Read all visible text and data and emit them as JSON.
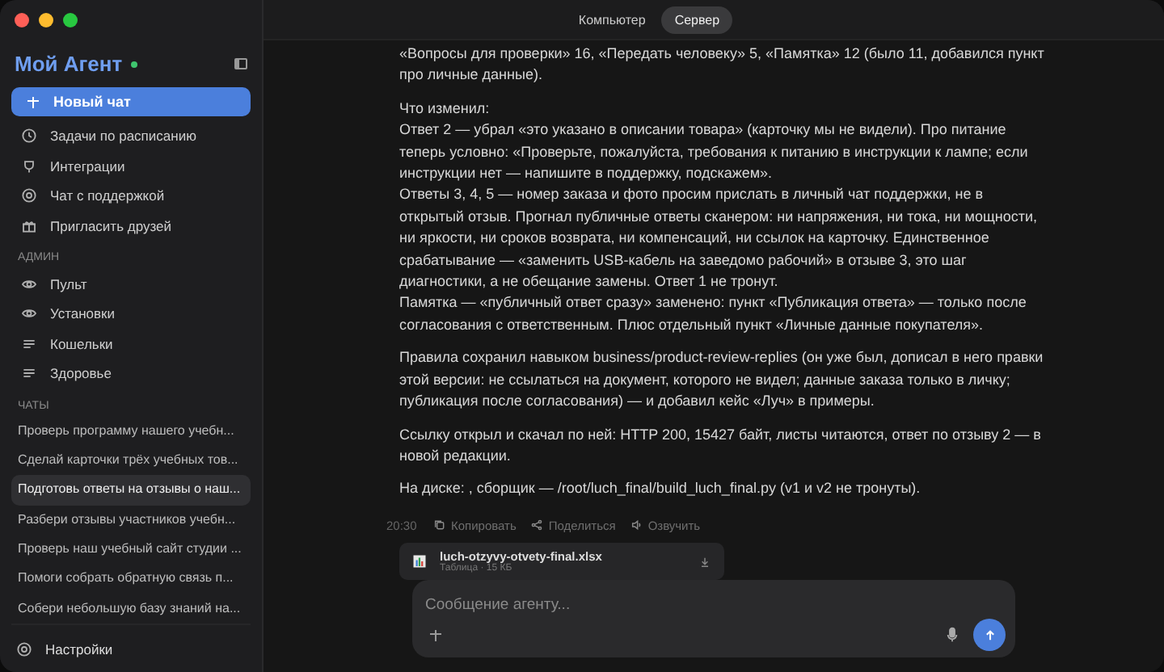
{
  "sidebar": {
    "title": "Мой Агент",
    "online": true,
    "new_chat": {
      "label": "Новый чат",
      "selected": true
    },
    "items": [
      {
        "kind": "clock",
        "label": "Задачи по расписанию"
      },
      {
        "kind": "plug",
        "label": "Интеграции"
      },
      {
        "kind": "support",
        "label": "Чат с поддержкой"
      },
      {
        "kind": "gift",
        "label": "Пригласить друзей"
      }
    ],
    "admin_heading": "АДМИН",
    "admin_items": [
      {
        "kind": "eye",
        "label": "Пульт"
      },
      {
        "kind": "eye",
        "label": "Установки"
      },
      {
        "kind": "lines",
        "label": "Кошельки"
      },
      {
        "kind": "lines",
        "label": "Здоровье"
      }
    ],
    "chats_heading": "ЧАТЫ",
    "chats": [
      {
        "label": "Проверь программу нашего учебн...",
        "selected": false
      },
      {
        "label": "Сделай карточки трёх учебных тов...",
        "selected": false
      },
      {
        "label": "Подготовь ответы на отзывы о наш...",
        "selected": true
      },
      {
        "label": "Разбери отзывы участников учебн...",
        "selected": false
      },
      {
        "label": "Проверь наш учебный сайт студии ...",
        "selected": false
      },
      {
        "label": "Помоги собрать обратную связь п...",
        "selected": false
      },
      {
        "label": "Собери небольшую базу знаний на...",
        "selected": false
      }
    ],
    "settings": "Настройки"
  },
  "mode_tabs": [
    {
      "label": "Компьютер",
      "selected": false
    },
    {
      "label": "Сервер",
      "selected": true
    }
  ],
  "message": {
    "paragraphs": [
      [
        "«Вопросы для проверки» 16, «Передать человеку» 5, «Памятка» 12 (было 11, добавился пункт про личные данные)."
      ],
      [
        "Что изменил:",
        "Ответ 2 — убрал «это указано в описании товара» (карточку мы не видели). Про питание теперь условно: «Проверьте, пожалуйста, требования к питанию в инструкции к лампе; если инструкции нет — напишите в поддержку, подскажем».",
        "Ответы 3, 4, 5 — номер заказа и фото просим прислать в личный чат поддержки, не в открытый отзыв. Прогнал публичные ответы сканером: ни напряжения, ни тока, ни мощности, ни яркости, ни сроков возврата, ни компенсаций, ни ссылок на карточку. Единственное срабатывание — «заменить USB-кабель на заведомо рабочий» в отзыве 3, это шаг диагностики, а не обещание замены. Ответ 1 не тронут.",
        "Памятка — «публичный ответ сразу» заменено: пункт «Публикация ответа» — только после согласования с ответственным. Плюс отдельный пункт «Личные данные покупателя»."
      ],
      [
        "Правила сохранил навыком business/product-review-replies (он уже был, дописал в него правки этой версии: не ссылаться на документ, которого не видел; данные заказа только в личку; публикация после согласования) — и добавил кейс «Луч» в примеры."
      ],
      [
        "Ссылку открыл и скачал по ней: HTTP 200, 15427 байт, листы читаются, ответ по отзыву 2 — в новой редакции."
      ],
      [
        "На диске: , сборщик — /root/luch_final/build_luch_final.py (v1 и v2 не тронуты)."
      ]
    ],
    "time": "20:30",
    "actions": [
      {
        "kind": "copy",
        "label": "Копировать"
      },
      {
        "kind": "share",
        "label": "Поделиться"
      },
      {
        "kind": "speaker",
        "label": "Озвучить"
      }
    ],
    "attachment": {
      "name": "luch-otzyvy-otvety-final.xlsx",
      "meta": "Таблица · 15 КБ"
    }
  },
  "composer": {
    "placeholder": "Сообщение агенту..."
  }
}
